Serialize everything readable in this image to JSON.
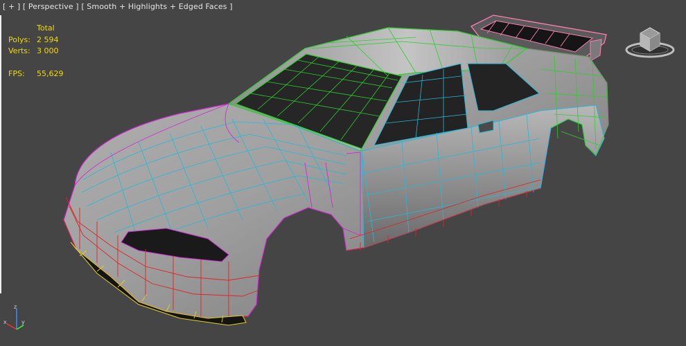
{
  "viewport": {
    "label_plus": "[ + ]",
    "label_view": "[ Perspective ]",
    "label_shading": "[ Smooth + Highlights + Edged Faces ]"
  },
  "stats": {
    "header": "Total",
    "polys_label": "Polys:",
    "polys_value": "2 594",
    "verts_label": "Verts:",
    "verts_value": "3 000",
    "fps_label": "FPS:",
    "fps_value": "55,629",
    "color": "#f2dc00"
  },
  "colors": {
    "background": "#454545",
    "roof_wire": "#2ad02a",
    "hood_wire": "#26b8d8",
    "fender_wire": "#d22ad2",
    "bumper_wire": "#e02424",
    "lip_wire": "#e6d21c",
    "spoiler_wire": "#ff7fb0",
    "body_shade": "#9a9a9a"
  },
  "axis_labels": {
    "x": "x",
    "y": "y",
    "z": "z"
  },
  "icons": {
    "viewcube": "viewcube-icon",
    "axis": "axis-tripod-icon"
  }
}
